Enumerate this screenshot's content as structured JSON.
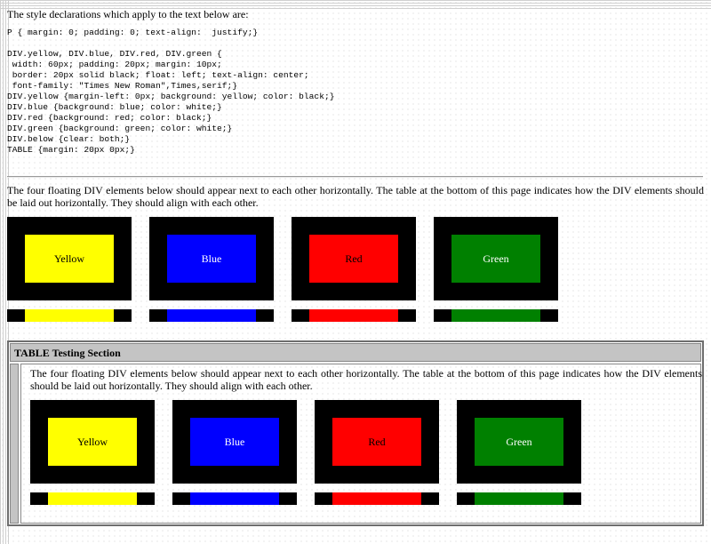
{
  "intro": "The style declarations which apply to the text below are:",
  "css_code": "P { margin: 0; padding: 0; text-align:  justify;}\n\nDIV.yellow, DIV.blue, DIV.red, DIV.green {\n width: 60px; padding: 20px; margin: 10px;\n border: 20px solid black; float: left; text-align: center;\n font-family: \"Times New Roman\",Times,serif;}\nDIV.yellow {margin-left: 0px; background: yellow; color: black;}\nDIV.blue {background: blue; color: white;}\nDIV.red {background: red; color: black;}\nDIV.green {background: green; color: white;}\nDIV.below {clear: both;}\nTABLE {margin: 20px 0px;}",
  "description": "The four floating DIV elements below should appear next to each other horizontally. The table at the bottom of this page indicates how the DIV elements should be laid out horizontally. They should align with each other.",
  "boxes": [
    {
      "label": "Yellow",
      "color": "#ffff00"
    },
    {
      "label": "Blue",
      "color": "#0000ff"
    },
    {
      "label": "Red",
      "color": "#ff0000"
    },
    {
      "label": "Green",
      "color": "#008000"
    }
  ],
  "table": {
    "heading": "TABLE Testing Section",
    "description": "The four floating DIV elements below should appear next to each other horizontally. The table at the bottom of this page indicates how the DIV elements should be laid out horizontally. They should align with each other.",
    "boxes": [
      {
        "label": "Yellow"
      },
      {
        "label": "Blue"
      },
      {
        "label": "Red"
      },
      {
        "label": "Green"
      }
    ]
  }
}
